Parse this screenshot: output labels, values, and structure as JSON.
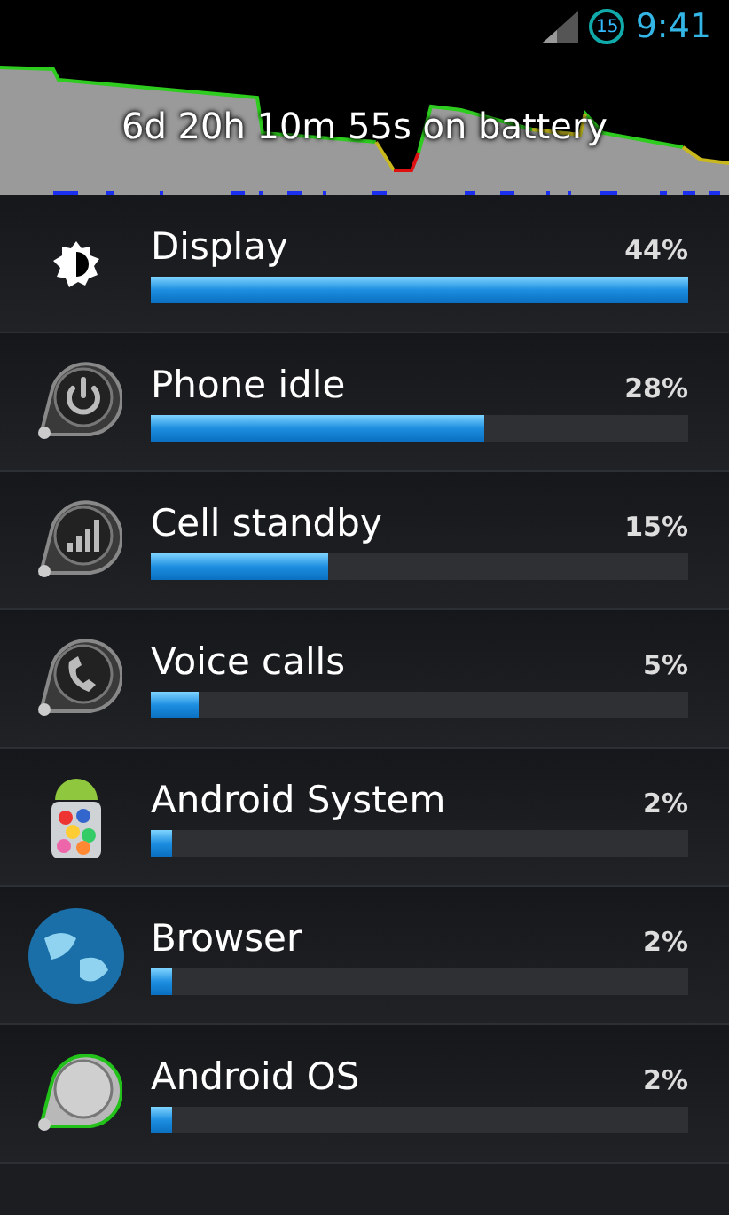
{
  "status_bar": {
    "time": "9:41",
    "alarm_badge": "15"
  },
  "graph": {
    "caption": "6d 20h 10m 55s on battery"
  },
  "items": [
    {
      "kind": "display",
      "name": "Display",
      "percent": "44%",
      "level": 1.0
    },
    {
      "kind": "power",
      "name": "Phone idle",
      "percent": "28%",
      "level": 0.62
    },
    {
      "kind": "signal",
      "name": "Cell standby",
      "percent": "15%",
      "level": 0.33
    },
    {
      "kind": "phone",
      "name": "Voice calls",
      "percent": "5%",
      "level": 0.09
    },
    {
      "kind": "android",
      "name": "Android System",
      "percent": "2%",
      "level": 0.04
    },
    {
      "kind": "globe",
      "name": "Browser",
      "percent": "2%",
      "level": 0.04
    },
    {
      "kind": "knob",
      "name": "Android OS",
      "percent": "2%",
      "level": 0.04
    }
  ]
}
